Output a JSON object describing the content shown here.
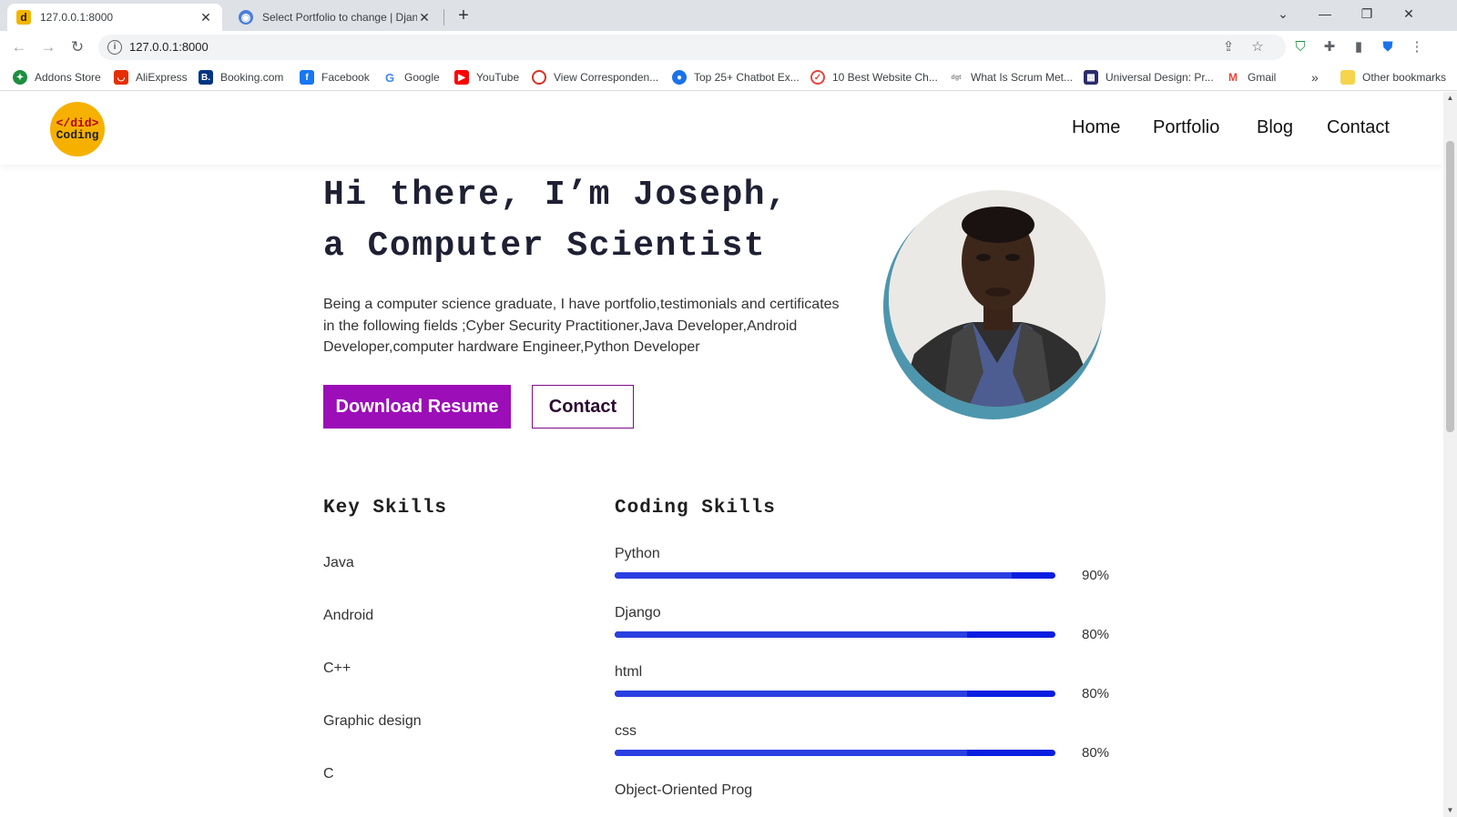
{
  "browser": {
    "tabs": [
      {
        "title": "127.0.0.1:8000",
        "active": true
      },
      {
        "title": "Select Portfolio to change | Djang",
        "active": false
      }
    ],
    "new_tab_symbol": "+",
    "close_symbol": "✕",
    "url": "127.0.0.1:8000",
    "bookmarks": [
      {
        "label": "Addons Store",
        "icon": "addons-store-icon",
        "color": "#1e8e3e"
      },
      {
        "label": "AliExpress",
        "icon": "aliexpress-icon",
        "color": "#e62e04"
      },
      {
        "label": "Booking.com",
        "icon": "booking-icon",
        "color": "#003580"
      },
      {
        "label": "Facebook",
        "icon": "facebook-icon",
        "color": "#1877f2"
      },
      {
        "label": "Google",
        "icon": "google-icon",
        "color": "#4285f4"
      },
      {
        "label": "YouTube",
        "icon": "youtube-icon",
        "color": "#ff0000"
      },
      {
        "label": "View Corresponden...",
        "icon": "opera-icon",
        "color": "#d93025"
      },
      {
        "label": "Top 25+ Chatbot Ex...",
        "icon": "chatbot-icon",
        "color": "#1a73e8"
      },
      {
        "label": "10 Best Website Ch...",
        "icon": "website-checker-icon",
        "color": "#e8453c"
      },
      {
        "label": "What Is Scrum Met...",
        "icon": "digite-icon",
        "color": "#888888"
      },
      {
        "label": "Universal Design: Pr...",
        "icon": "universal-design-icon",
        "color": "#2b2b6b"
      },
      {
        "label": "Gmail",
        "icon": "gmail-icon",
        "color": "#ea4335"
      }
    ],
    "overflow_symbol": "»",
    "other_bookmarks": "Other bookmarks"
  },
  "site": {
    "logo_line1": "</did>",
    "logo_line2": "Coding",
    "nav": [
      "Home",
      "Portfolio",
      "Blog",
      "Contact"
    ],
    "hero": {
      "title_line1": "Hi there, I’m Joseph,",
      "title_line2": "a Computer Scientist",
      "text": "Being a computer science graduate, I have portfolio,testimonials and certificates in the following fields ;Cyber Security Practitioner,Java Developer,Android Developer,computer hardware Engineer,Python Developer",
      "primary_button": "Download Resume",
      "secondary_button": "Contact"
    },
    "key_skills_heading": "Key Skills",
    "key_skills": [
      "Java",
      "Android",
      "C++",
      "Graphic design",
      "C"
    ],
    "coding_skills_heading": "Coding Skills",
    "coding_skills": [
      {
        "name": "Python",
        "percent_label": "90%",
        "level": 0.9
      },
      {
        "name": "Django",
        "percent_label": "80%",
        "level": 0.8
      },
      {
        "name": "html",
        "percent_label": "80%",
        "level": 0.8
      },
      {
        "name": "css",
        "percent_label": "80%",
        "level": 0.8
      },
      {
        "name": "Object-Oriented Prog",
        "percent_label": "",
        "level": null
      }
    ],
    "colors": {
      "accent_purple": "#9c0eb8",
      "logo_yellow": "#f6b100",
      "avatar_ring": "#4e96ad",
      "bar_blue": "#0a1ee0"
    }
  }
}
